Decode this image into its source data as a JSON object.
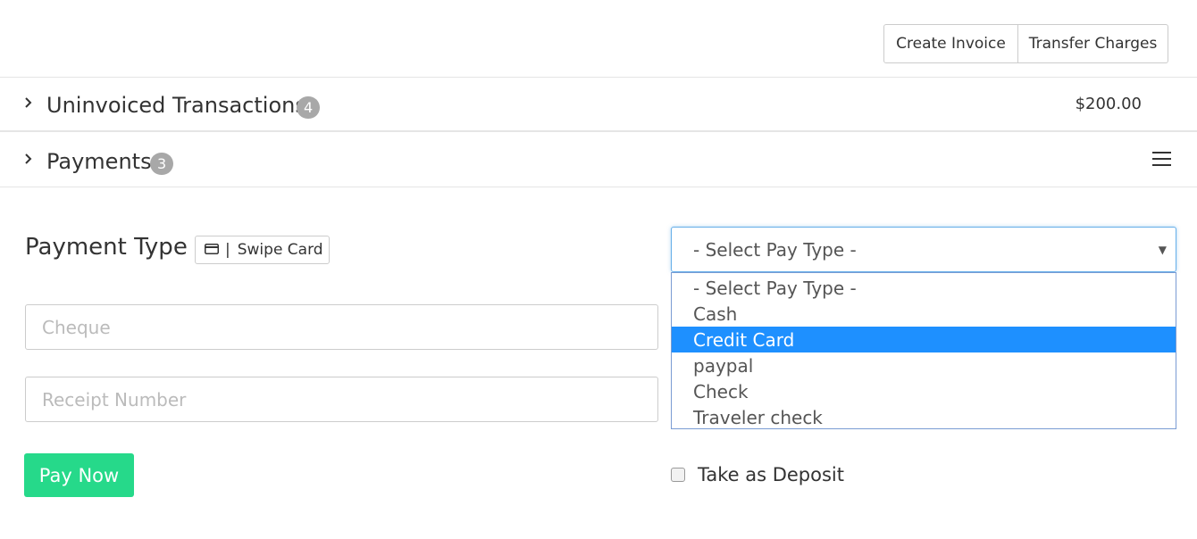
{
  "toolbar": {
    "create_invoice": "Create Invoice",
    "transfer_charges": "Transfer Charges"
  },
  "uninvoiced": {
    "title": "Uninvoiced Transactions",
    "count": "4",
    "amount": "$200.00"
  },
  "payments": {
    "title": "Payments",
    "count": "3"
  },
  "form": {
    "payment_type_label": "Payment Type",
    "swipe_card_label": "Swipe Card",
    "swipe_separator": "|",
    "cheque_placeholder": "Cheque",
    "receipt_placeholder": "Receipt Number",
    "pay_now": "Pay Now",
    "take_as_deposit": "Take as Deposit",
    "pay_type_select": {
      "selected": "- Select Pay Type -",
      "options": [
        "- Select Pay Type -",
        "Cash",
        "Credit Card",
        "paypal",
        "Check",
        "Traveler check"
      ],
      "highlighted_option": "Credit Card"
    }
  },
  "colors": {
    "accent_green": "#26d98a",
    "highlight_blue": "#1e90ff",
    "badge_gray": "#a8a8a8"
  },
  "icons": {
    "chevron": "chevron-right-icon",
    "menu": "hamburger-menu-icon",
    "card": "credit-card-icon",
    "select_arrow": "caret-down-icon"
  }
}
